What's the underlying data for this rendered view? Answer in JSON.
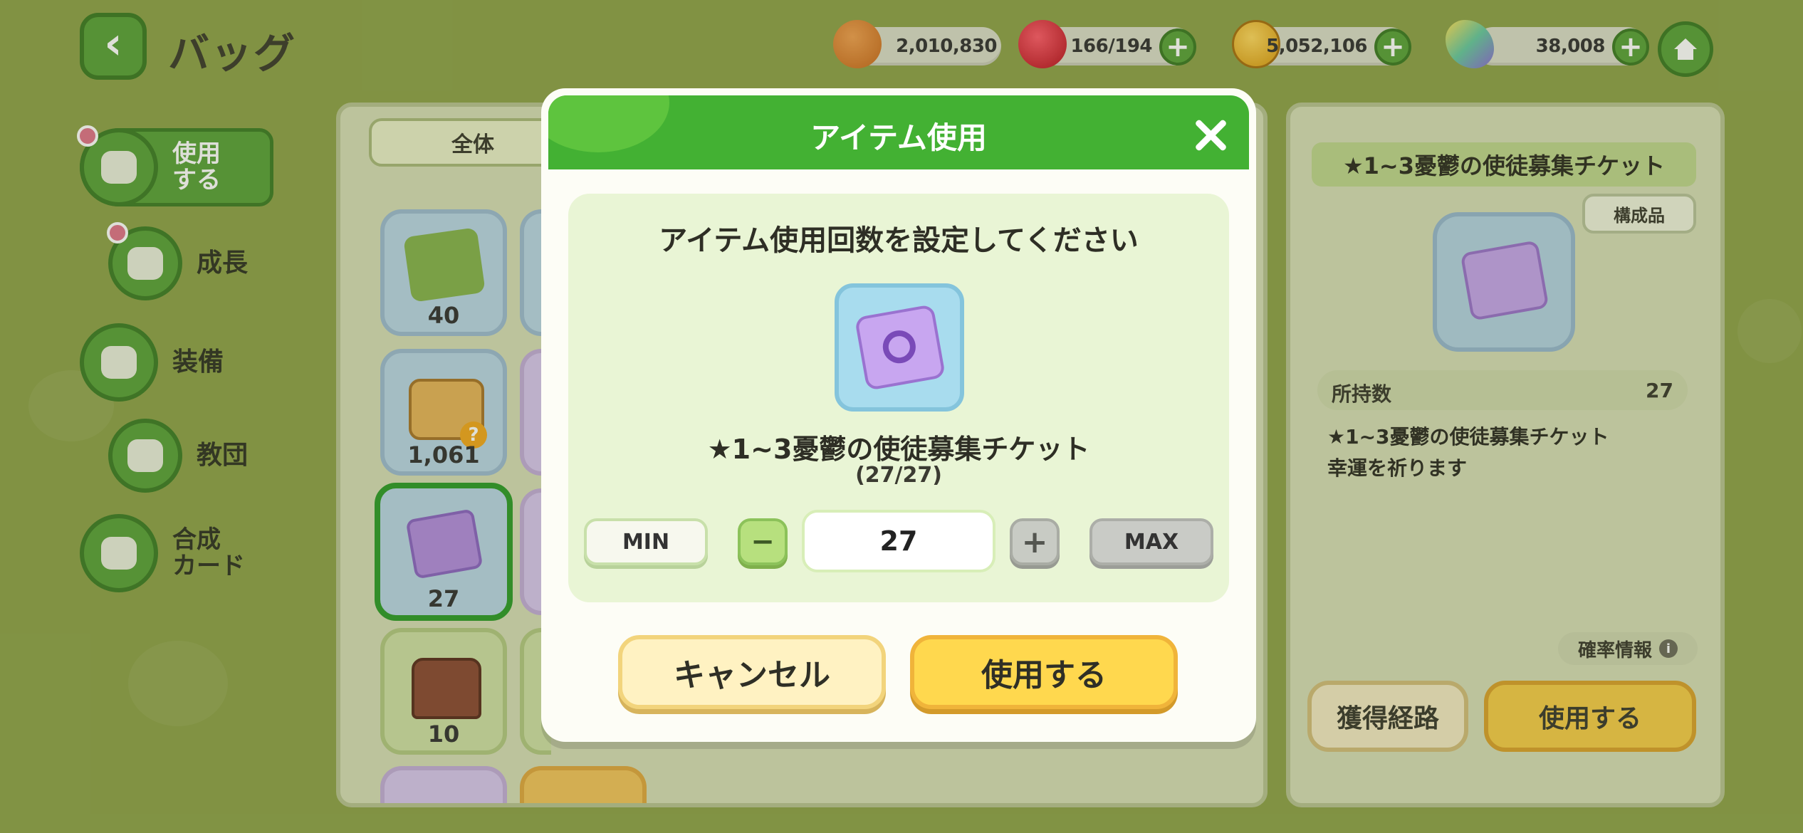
{
  "header": {
    "title": "バッグ",
    "currencies": [
      {
        "icon": "dorayaki-icon",
        "amount": "2,010,830",
        "has_plus": false
      },
      {
        "icon": "red-candy-icon",
        "amount": "166/194",
        "has_plus": true
      },
      {
        "icon": "gold-coin-icon",
        "amount": "5,052,106",
        "has_plus": true
      },
      {
        "icon": "butterfly-icon",
        "amount": "38,008",
        "has_plus": true
      }
    ],
    "plus": "+"
  },
  "sidebar": {
    "items": [
      {
        "label": "使用\nする",
        "icon": "chest-icon"
      },
      {
        "label": "成長",
        "icon": "growth-icon"
      },
      {
        "label": "装備",
        "icon": "equipment-icon"
      },
      {
        "label": "教団",
        "icon": "temple-icon"
      },
      {
        "label": "合成\nカード",
        "icon": "card-icon"
      }
    ]
  },
  "center": {
    "tab_all": "全体",
    "cards": [
      {
        "icon": "green-book-icon",
        "count": "40"
      },
      {
        "icon": "treasure-box-icon",
        "count": "1,061"
      },
      {
        "icon": "purple-ticket-icon",
        "count": "27"
      },
      {
        "icon": "chest-icon",
        "count": "10"
      }
    ]
  },
  "detail": {
    "title": "★1~3憂鬱の使徒募集チケット",
    "component_button": "構成品",
    "owned_label": "所持数",
    "owned_value": "27",
    "description_line1": "★1~3憂鬱の使徒募集チケット",
    "description_line2": "幸運を祈ります",
    "probability_label": "確率情報",
    "obtain_button": "獲得経路",
    "use_button": "使用する"
  },
  "modal": {
    "title": "アイテム使用",
    "prompt": "アイテム使用回数を設定してください",
    "item_name": "★1~3憂鬱の使徒募集チケット",
    "item_count": "(27/27)",
    "min_label": "MIN",
    "minus_label": "−",
    "quantity": "27",
    "plus_label": "+",
    "max_label": "MAX",
    "cancel_label": "キャンセル",
    "confirm_label": "使用する"
  },
  "colors": {
    "background": "#8ea24a",
    "modal_header": "#43b133",
    "accent_yellow": "#ffd84e"
  }
}
